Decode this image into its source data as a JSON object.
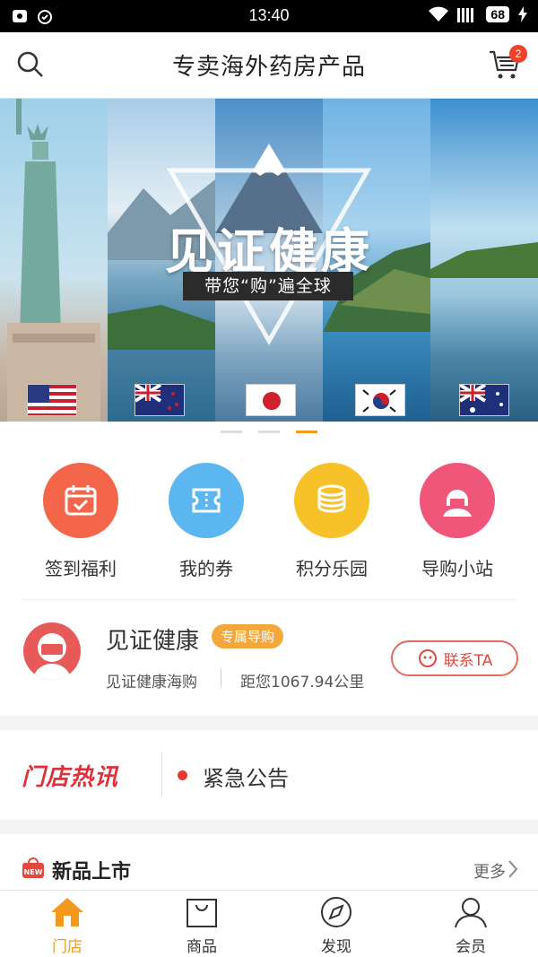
{
  "status_bar": {
    "time": "13:40",
    "battery": "68"
  },
  "header": {
    "title": "专卖海外药房产品",
    "cart_count": "2"
  },
  "banner": {
    "title": "见证健康",
    "subtitle": "带您“购”遍全球",
    "page_count": 3,
    "active_page": 2
  },
  "quick_nav": [
    {
      "label": "签到福利",
      "icon": "calendar-check-icon",
      "color": "#f4664a"
    },
    {
      "label": "我的券",
      "icon": "ticket-icon",
      "color": "#5cb7f0"
    },
    {
      "label": "积分乐园",
      "icon": "coin-stack-icon",
      "color": "#f7c129"
    },
    {
      "label": "导购小站",
      "icon": "guide-person-icon",
      "color": "#f0557a"
    }
  ],
  "guide": {
    "name": "见证健康",
    "tag": "专属导购",
    "store": "见证健康海购",
    "distance": "距您1067.94公里",
    "contact_label": "联系TA"
  },
  "news": {
    "brand": "门店热讯",
    "notice": "紧急公告"
  },
  "new_arrivals": {
    "title": "新品上市",
    "more": "更多"
  },
  "tab_bar": [
    {
      "label": "门店",
      "icon": "home-icon",
      "active": true
    },
    {
      "label": "商品",
      "icon": "shopping-bag-icon",
      "active": false
    },
    {
      "label": "发现",
      "icon": "compass-icon",
      "active": false
    },
    {
      "label": "会员",
      "icon": "user-icon",
      "active": false
    }
  ],
  "colors": {
    "accent": "#f39a1e",
    "red": "#e1483f"
  }
}
